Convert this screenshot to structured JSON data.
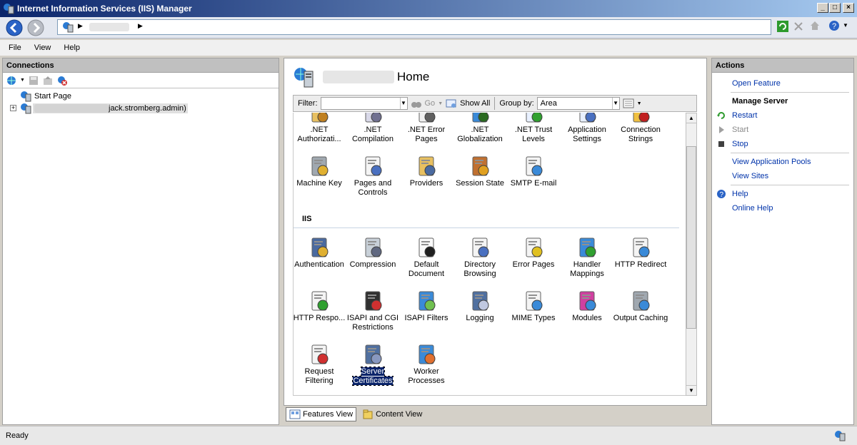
{
  "window": {
    "title": "Internet Information Services (IIS) Manager"
  },
  "menu": {
    "file": "File",
    "view": "View",
    "help": "Help"
  },
  "connections": {
    "header": "Connections",
    "tree": [
      {
        "label": "Start Page"
      },
      {
        "label": "jack.stromberg.admin)"
      }
    ]
  },
  "center": {
    "title": "Home",
    "filter_label": "Filter:",
    "go_label": "Go",
    "show_all_label": "Show All",
    "group_by_label": "Group by:",
    "group_by_value": "Area",
    "aspnet_items": [
      {
        "label": ".NET Authorizati...",
        "icon": "lock-folder-icon"
      },
      {
        "label": ".NET Compilation",
        "icon": "compile-icon"
      },
      {
        "label": ".NET Error Pages",
        "icon": "error-404-icon"
      },
      {
        "label": ".NET Globalization",
        "icon": "globe-icon"
      },
      {
        "label": ".NET Trust Levels",
        "icon": "trust-check-icon"
      },
      {
        "label": "Application Settings",
        "icon": "settings-list-icon"
      },
      {
        "label": "Connection Strings",
        "icon": "connection-ab-icon"
      },
      {
        "label": "Machine Key",
        "icon": "key-server-icon"
      },
      {
        "label": "Pages and Controls",
        "icon": "pages-controls-icon"
      },
      {
        "label": "Providers",
        "icon": "providers-icon"
      },
      {
        "label": "Session State",
        "icon": "session-user-icon"
      },
      {
        "label": "SMTP E-mail",
        "icon": "email-icon"
      }
    ],
    "iis_group": "IIS",
    "iis_items": [
      {
        "label": "Authentication",
        "icon": "auth-user-icon"
      },
      {
        "label": "Compression",
        "icon": "compression-icon"
      },
      {
        "label": "Default Document",
        "icon": "default-doc-icon"
      },
      {
        "label": "Directory Browsing",
        "icon": "dir-browse-icon"
      },
      {
        "label": "Error Pages",
        "icon": "error-page-icon"
      },
      {
        "label": "Handler Mappings",
        "icon": "handler-icon"
      },
      {
        "label": "HTTP Redirect",
        "icon": "redirect-icon"
      },
      {
        "label": "HTTP Respo...",
        "icon": "http-response-icon"
      },
      {
        "label": "ISAPI and CGI Restrictions",
        "icon": "cgi-icon"
      },
      {
        "label": "ISAPI Filters",
        "icon": "isapi-filter-icon"
      },
      {
        "label": "Logging",
        "icon": "logging-icon"
      },
      {
        "label": "MIME Types",
        "icon": "mime-icon"
      },
      {
        "label": "Modules",
        "icon": "modules-icon"
      },
      {
        "label": "Output Caching",
        "icon": "output-cache-icon"
      },
      {
        "label": "Request Filtering",
        "icon": "request-filter-icon"
      },
      {
        "label": "Server Certificates",
        "icon": "certificates-icon"
      },
      {
        "label": "Worker Processes",
        "icon": "worker-icon"
      }
    ],
    "features_view": "Features View",
    "content_view": "Content View"
  },
  "actions": {
    "header": "Actions",
    "open_feature": "Open Feature",
    "manage_server": "Manage Server",
    "restart": "Restart",
    "start": "Start",
    "stop": "Stop",
    "view_app_pools": "View Application Pools",
    "view_sites": "View Sites",
    "help": "Help",
    "online_help": "Online Help"
  },
  "status": {
    "text": "Ready"
  }
}
